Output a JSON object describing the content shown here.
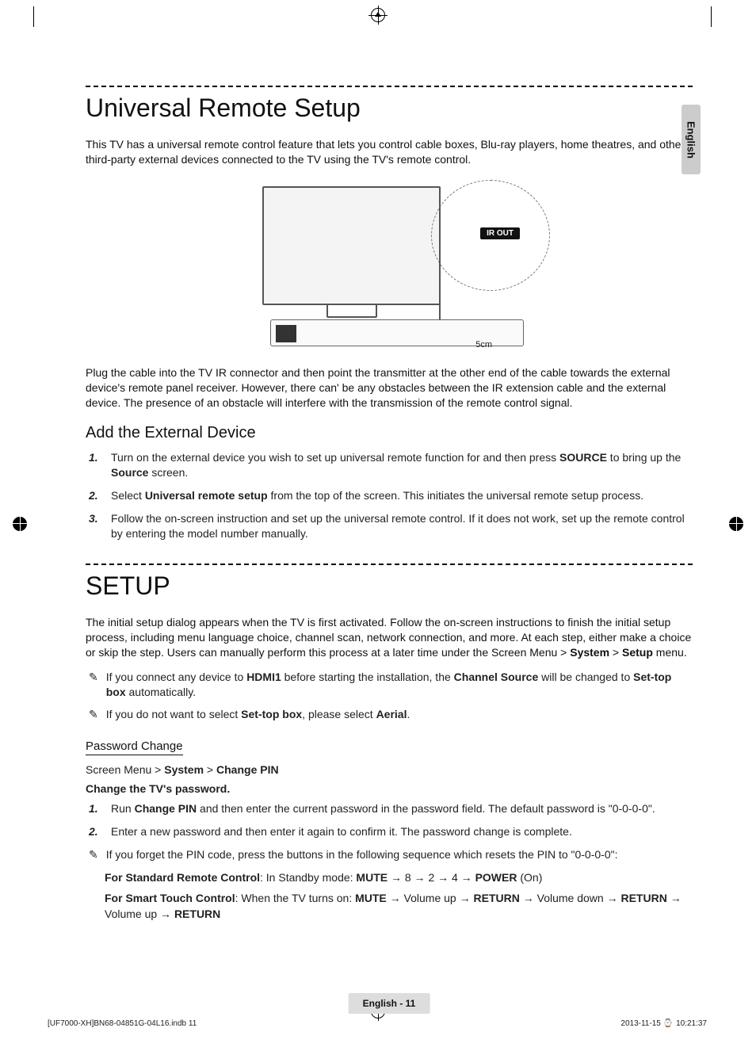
{
  "language_tab": "English",
  "figure": {
    "ir_label": "IR OUT",
    "distance": "5cm"
  },
  "section1": {
    "title": "Universal Remote Setup",
    "intro": "This TV has a universal remote control feature that lets you control cable boxes, Blu-ray players, home theatres, and other third-party external devices connected to the TV using the TV's remote control.",
    "para2": "Plug the cable into the TV IR connector and then point the transmitter at the other end of the cable towards the external device's remote panel receiver. However, there can' be any obstacles between the IR extension cable and the external device. The presence of an obstacle will interfere with the transmission of the remote control signal.",
    "subhead": "Add the External Device",
    "steps": [
      {
        "num": "1.",
        "pre": "Turn on the external device you wish to set up universal remote function for and then press ",
        "b1": "SOURCE",
        "mid": " to bring up the ",
        "b2": "Source",
        "post": " screen."
      },
      {
        "num": "2.",
        "pre": "Select ",
        "b1": "Universal remote setup",
        "post": " from the top of the screen. This initiates the universal remote setup process."
      },
      {
        "num": "3.",
        "pre": "Follow the on-screen instruction and set up the universal remote control. If it does not work, set up the remote control by entering the model number manually."
      }
    ]
  },
  "section2": {
    "title": "SETUP",
    "intro_pre": "The initial setup dialog appears when the TV is first activated. Follow the on-screen instructions to finish the initial setup process, including menu language choice, channel scan, network connection, and more. At each step, either make a choice or skip the step. Users can manually perform this process at a later time under the Screen Menu > ",
    "intro_b1": "System",
    "intro_mid": " > ",
    "intro_b2": "Setup",
    "intro_post": " menu.",
    "notes": [
      {
        "pre": "If you connect any device to ",
        "b1": "HDMI1",
        "mid": " before starting the installation, the ",
        "b2": "Channel Source",
        "mid2": " will be changed to ",
        "b3": "Set-top box",
        "post": " automatically."
      },
      {
        "pre": "If you do not want to select ",
        "b1": "Set-top box",
        "mid": ", please select ",
        "b2": "Aerial",
        "post": "."
      }
    ],
    "pw_heading": "Password Change",
    "pw_path_pre": "Screen Menu > ",
    "pw_path_b1": "System",
    "pw_path_mid": " > ",
    "pw_path_b2": "Change PIN",
    "pw_lead": "Change the TV's password.",
    "pw_steps": [
      {
        "num": "1.",
        "pre": "Run ",
        "b1": "Change PIN",
        "post": " and then enter the current password in the password field. The default password is \"0-0-0-0\"."
      },
      {
        "num": "2.",
        "pre": "Enter a new password and then enter it again to confirm it. The password change is complete."
      }
    ],
    "pw_note": "If you forget the PIN code, press the buttons in the following sequence which resets the PIN to \"0-0-0-0\":",
    "reset1_pre": "For Standard Remote Control",
    "reset1_mid": ": In Standby mode: ",
    "reset1_seq_b1": "MUTE",
    "reset1_seq_mid": " → 8 → 2 → 4 → ",
    "reset1_seq_b2": "POWER",
    "reset1_seq_post": " (On)",
    "reset2_pre": "For Smart Touch Control",
    "reset2_mid": ": When the TV turns on: ",
    "reset2_b1": "MUTE",
    "reset2_t1": " → Volume up → ",
    "reset2_b2": "RETURN",
    "reset2_t2": " → Volume down → ",
    "reset2_b3": "RETURN",
    "reset2_t3": " → Volume up → ",
    "reset2_b4": "RETURN"
  },
  "page_label": "English - 11",
  "footer": {
    "left": "[UF7000-XH]BN68-04851G-04L16.indb   11",
    "right_time": "2013-11-15   ",
    "right_time2": "10:21:37"
  },
  "icons": {
    "hand": "✎",
    "clock": "⌚"
  }
}
